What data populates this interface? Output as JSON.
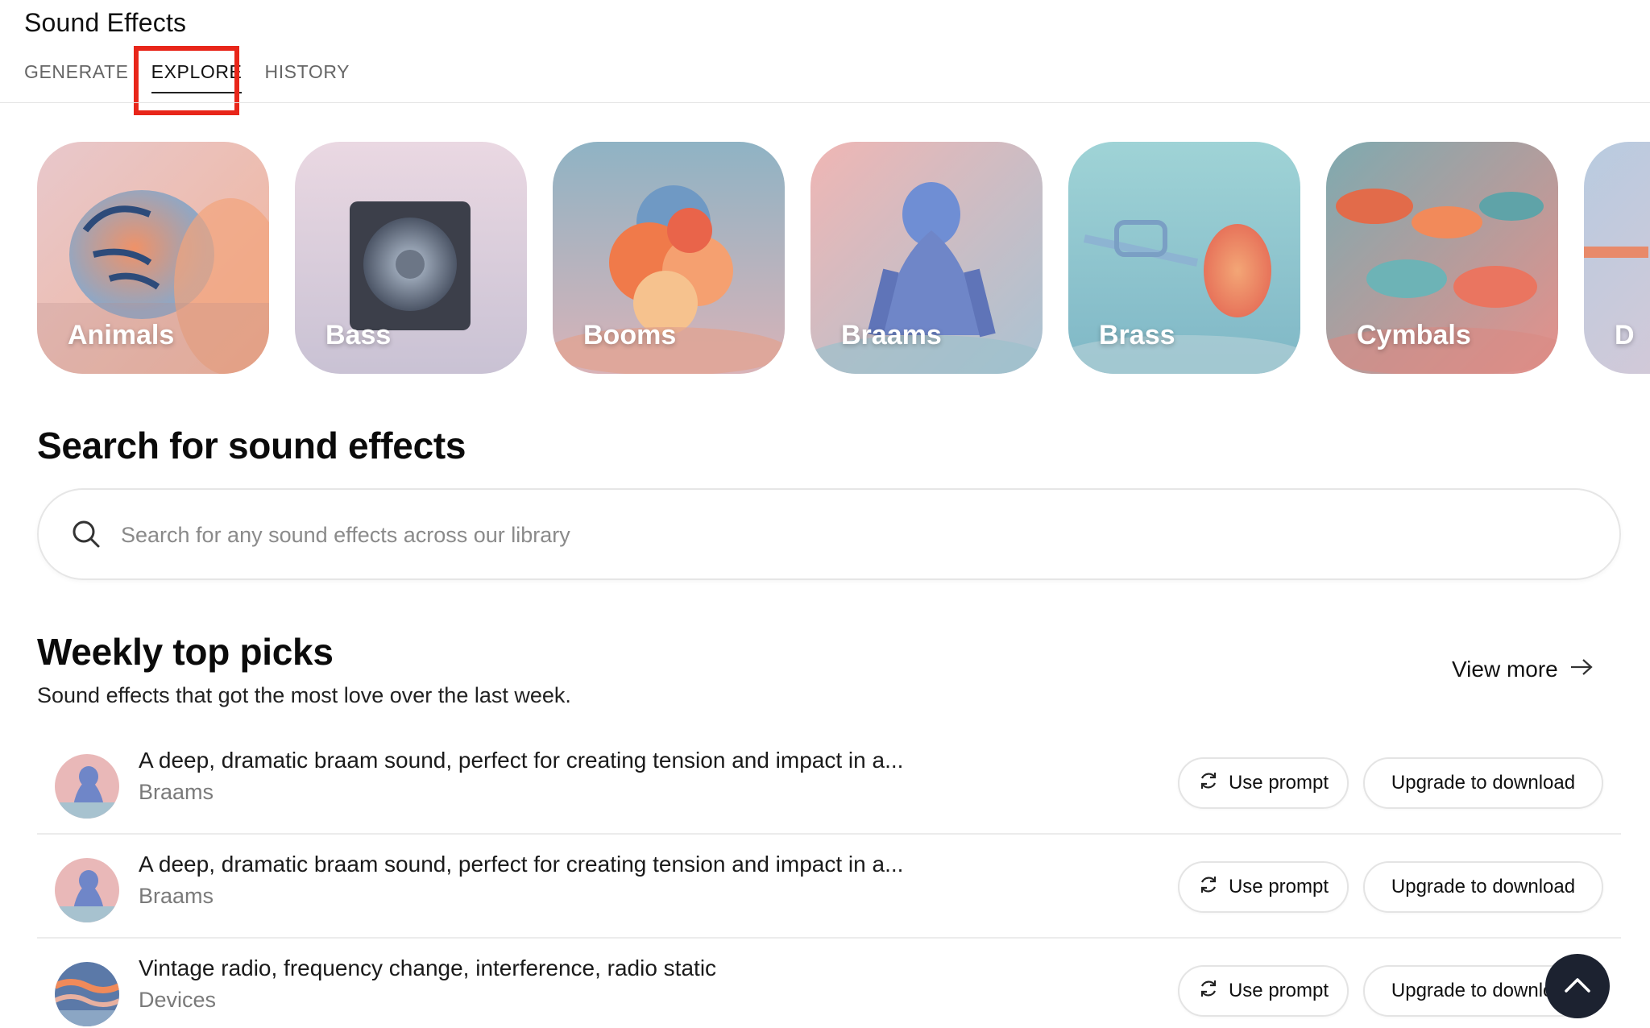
{
  "app": {
    "title": "Sound Effects"
  },
  "tabs": [
    {
      "label": "GENERATE"
    },
    {
      "label": "EXPLORE"
    },
    {
      "label": "HISTORY"
    }
  ],
  "categories": [
    {
      "label": "Animals",
      "icon": "tiger-image"
    },
    {
      "label": "Bass",
      "icon": "speaker-image"
    },
    {
      "label": "Booms",
      "icon": "explosion-image"
    },
    {
      "label": "Braams",
      "icon": "gorilla-image"
    },
    {
      "label": "Brass",
      "icon": "trumpet-image"
    },
    {
      "label": "Cymbals",
      "icon": "cymbals-image"
    },
    {
      "label": "D",
      "icon": "partial-category-image"
    }
  ],
  "search": {
    "heading": "Search for sound effects",
    "placeholder": "Search for any sound effects across our library",
    "icon": "search-icon"
  },
  "weekly": {
    "heading": "Weekly top picks",
    "subtitle": "Sound effects that got the most love over the last week.",
    "view_more": "View more",
    "items": [
      {
        "description": "A deep, dramatic braam sound, perfect for creating tension and impact in a...",
        "category": "Braams",
        "use_prompt": "Use prompt",
        "upgrade": "Upgrade to download"
      },
      {
        "description": "A deep, dramatic braam sound, perfect for creating tension and impact in a...",
        "category": "Braams",
        "use_prompt": "Use prompt",
        "upgrade": "Upgrade to download"
      },
      {
        "description": "Vintage radio, frequency change, interference, radio static",
        "category": "Devices",
        "use_prompt": "Use prompt",
        "upgrade": "Upgrade to download"
      }
    ]
  },
  "colors": {
    "highlight": "#e8261a",
    "text_primary": "#111111",
    "text_muted": "#7a7a7a",
    "scroll_button": "#1c2230"
  }
}
